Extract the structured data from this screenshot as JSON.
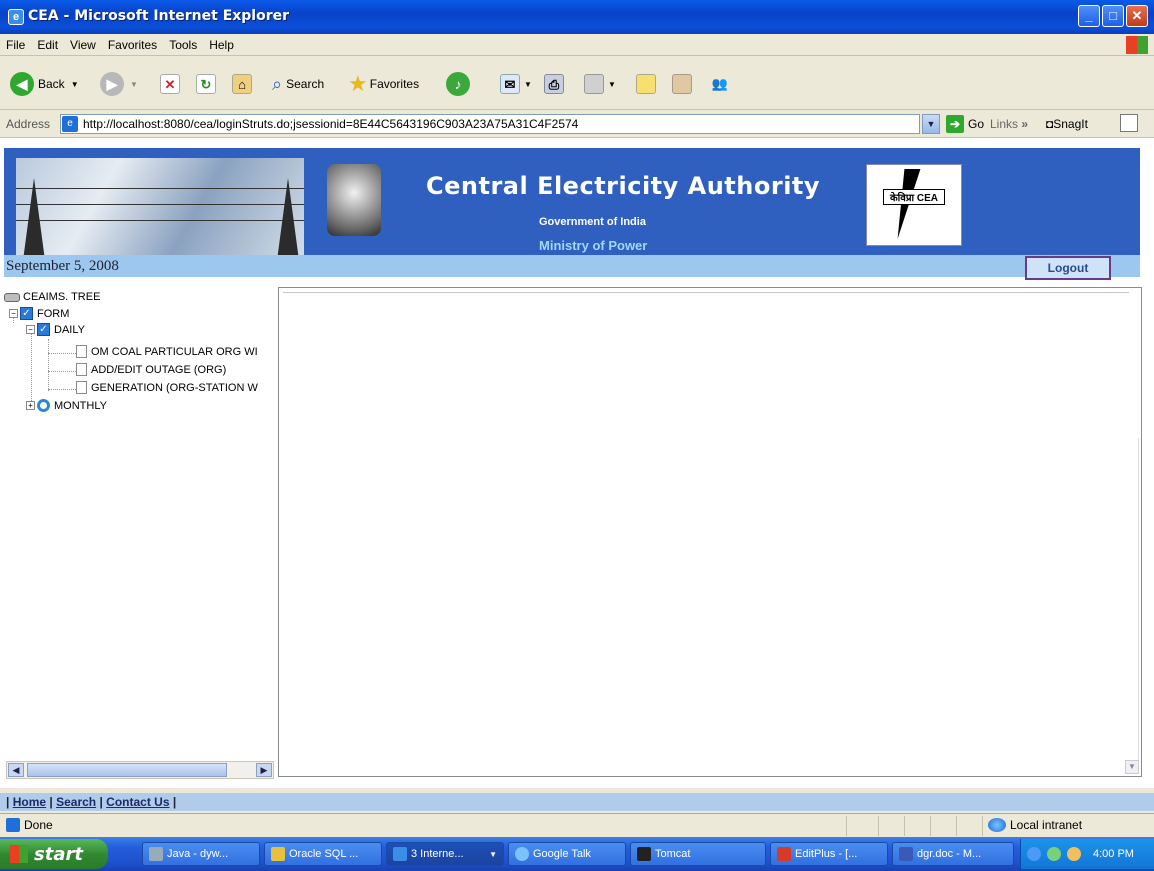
{
  "window": {
    "title": "CEA - Microsoft Internet Explorer",
    "controls": {
      "minimize": "_",
      "maximize": "□",
      "close": "✕"
    }
  },
  "menu": [
    "File",
    "Edit",
    "View",
    "Favorites",
    "Tools",
    "Help"
  ],
  "toolbar": {
    "back": "Back",
    "search": "Search",
    "favorites": "Favorites"
  },
  "address": {
    "label": "Address",
    "url": "http://localhost:8080/cea/loginStruts.do;jsessionid=8E44C5643196C903A23A75A31C4F2574",
    "go": "Go",
    "links": "Links",
    "links_more": "»",
    "snagit": "SnagIt"
  },
  "banner": {
    "title": "Central Electricity Authority",
    "subtitle1": "Government of India",
    "subtitle2": "Ministry of Power",
    "logo_text": "केविप्रा CEA"
  },
  "date": "September 5, 2008",
  "logout_label": "Logout",
  "tree": {
    "root": "CEAIMS. TREE",
    "form": "FORM",
    "daily": "DAILY",
    "daily_items": [
      "OM COAL PARTICULAR ORG WI",
      "ADD/EDIT OUTAGE (ORG)",
      "GENERATION (ORG-STATION W"
    ],
    "monthly": "MONTHLY"
  },
  "footer": {
    "sep": "|",
    "links": [
      "Home",
      "Search",
      "Contact Us"
    ]
  },
  "status": {
    "text": "Done",
    "zone": "Local intranet"
  },
  "taskbar": {
    "start": "start",
    "tasks": [
      "Java - dyw...",
      "Oracle SQL ...",
      "3 Interne...",
      "Google Talk",
      "Tomcat",
      "EditPlus - [...",
      "dgr.doc - M..."
    ],
    "clock": "4:00 PM"
  },
  "colors": {
    "banner_bg": "#2f5fbf",
    "datebar_bg": "#9cc8f0",
    "footer_bg": "#b0ccea",
    "titlebar": "#0a5ae8",
    "taskbar": "#245edb"
  }
}
